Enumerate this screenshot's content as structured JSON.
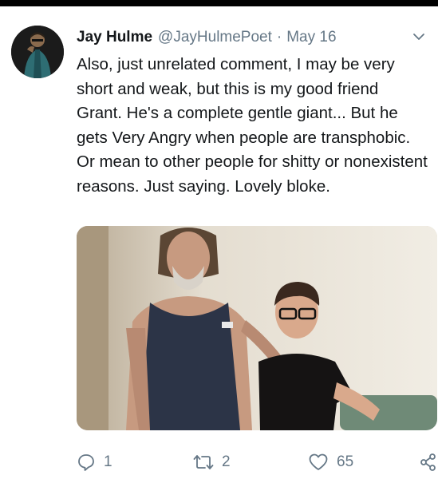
{
  "tweet": {
    "author_name": "Jay Hulme",
    "author_handle": "@JayHulmePoet",
    "separator": "·",
    "date": "May 16",
    "text": "Also, just unrelated comment, I may be very short and weak, but this is my good friend Grant. He's a complete gentle giant... But he gets Very Angry when people are transphobic. Or mean to other people for shitty or nonexistent reasons. Just saying. Lovely bloke."
  },
  "actions": {
    "reply_count": "1",
    "retweet_count": "2",
    "like_count": "65"
  },
  "icons": {
    "reply": "reply-icon",
    "retweet": "retweet-icon",
    "like": "heart-icon",
    "share": "share-icon",
    "menu": "chevron-down-icon"
  },
  "colors": {
    "text": "#14171a",
    "secondary": "#657786",
    "background": "#ffffff"
  }
}
